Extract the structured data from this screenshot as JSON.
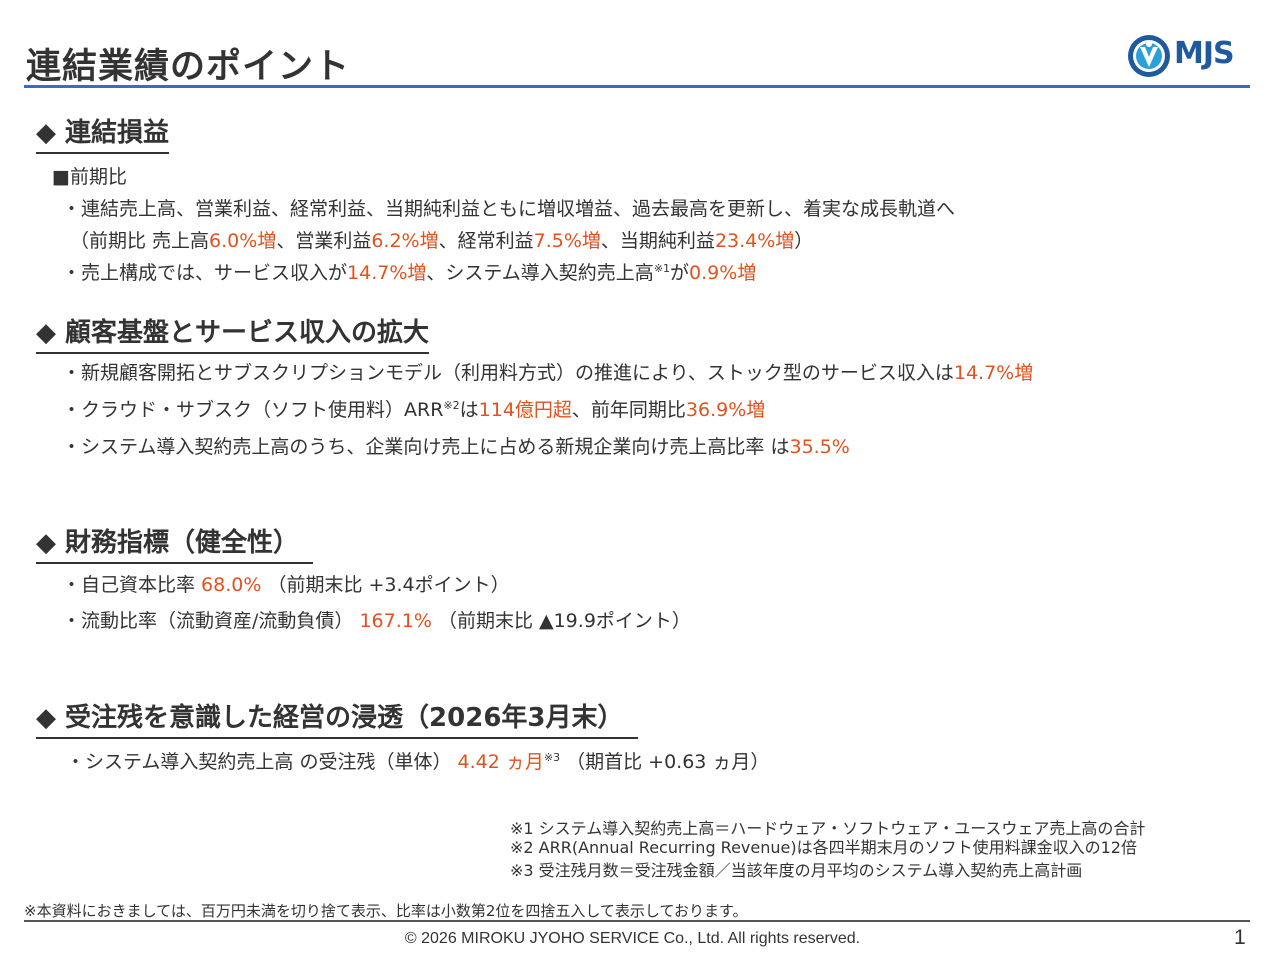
{
  "title": "連結業績のポイント",
  "logo": {
    "text": "MJS"
  },
  "sections": {
    "s1": {
      "heading": "◆ 連結損益",
      "sub": "■前期比",
      "l1": "・連結売上高、営業利益、経常利益、当期純利益ともに増収増益、過去最高を更新し、着実な成長軌道へ",
      "l2": {
        "a": "（前期比 売上高",
        "b": "6.0%増",
        "c": "、営業利益",
        "d": "6.2%増",
        "e": "、経常利益",
        "f": "7.5%増",
        "g": "、当期純利益",
        "h": "23.4%増",
        "i": "）"
      },
      "l3": {
        "a": "・売上構成では、サービス収入が",
        "b": "14.7%増",
        "c": "、システム導入契約売上高",
        "sup": "※1",
        "d": "が",
        "e": "0.9%増"
      }
    },
    "s2": {
      "heading": "◆ 顧客基盤とサービス収入の拡大",
      "l1": {
        "a": "・新規顧客開拓とサブスクリプションモデル（利用料方式）の推進により、ストック型のサービス収入は",
        "b": "14.7%増"
      },
      "l2": {
        "a": "・クラウド・サブスク（ソフト使用料）ARR",
        "sup": "※2",
        "b": "は",
        "c": "114億円超",
        "d": "、前年同期比",
        "e": "36.9%増"
      },
      "l3": {
        "a": "・システム導入契約売上高のうち、企業向け売上に占める新規企業向け売上高比率 は",
        "b": "35.5%"
      }
    },
    "s3": {
      "heading": "◆ 財務指標（健全性）",
      "l1": {
        "a": "・自己資本比率 ",
        "b": "68.0%",
        "c": " （前期末比 +3.4ポイント）"
      },
      "l2": {
        "a": "・流動比率（流動資産/流動負債） ",
        "b": "167.1%",
        "c": " （前期末比 ▲19.9ポイント）"
      }
    },
    "s4": {
      "heading": "◆ 受注残を意識した経営の浸透（2026年3月末）",
      "l1": {
        "a": "・システム導入契約売上高 の受注残（単体） ",
        "b": "4.42 ヵ月",
        "sup": "※3",
        "c": " （期首比 +0.63 ヵ月）"
      }
    }
  },
  "notes": [
    "※1 システム導入契約売上高＝ハードウェア・ソフトウェア・ユースウェア売上高の合計",
    "※2 ARR(Annual Recurring Revenue)は各四半期末月のソフト使用料課金収入の12倍",
    "※3 受注残月数＝受注残金額／当該年度の月平均のシステム導入契約売上高計画"
  ],
  "disclaimer": "※本資料におきましては、百万円未満を切り捨て表示、比率は小数第2位を四捨五入して表示しております。",
  "copyright": "© 2026 MIROKU JYOHO SERVICE Co., Ltd. All rights reserved.",
  "page_number": "1",
  "colors": {
    "accent_rule": "#2f6fc8",
    "highlight": "#e0531f",
    "logo": "#1f5a9e"
  }
}
